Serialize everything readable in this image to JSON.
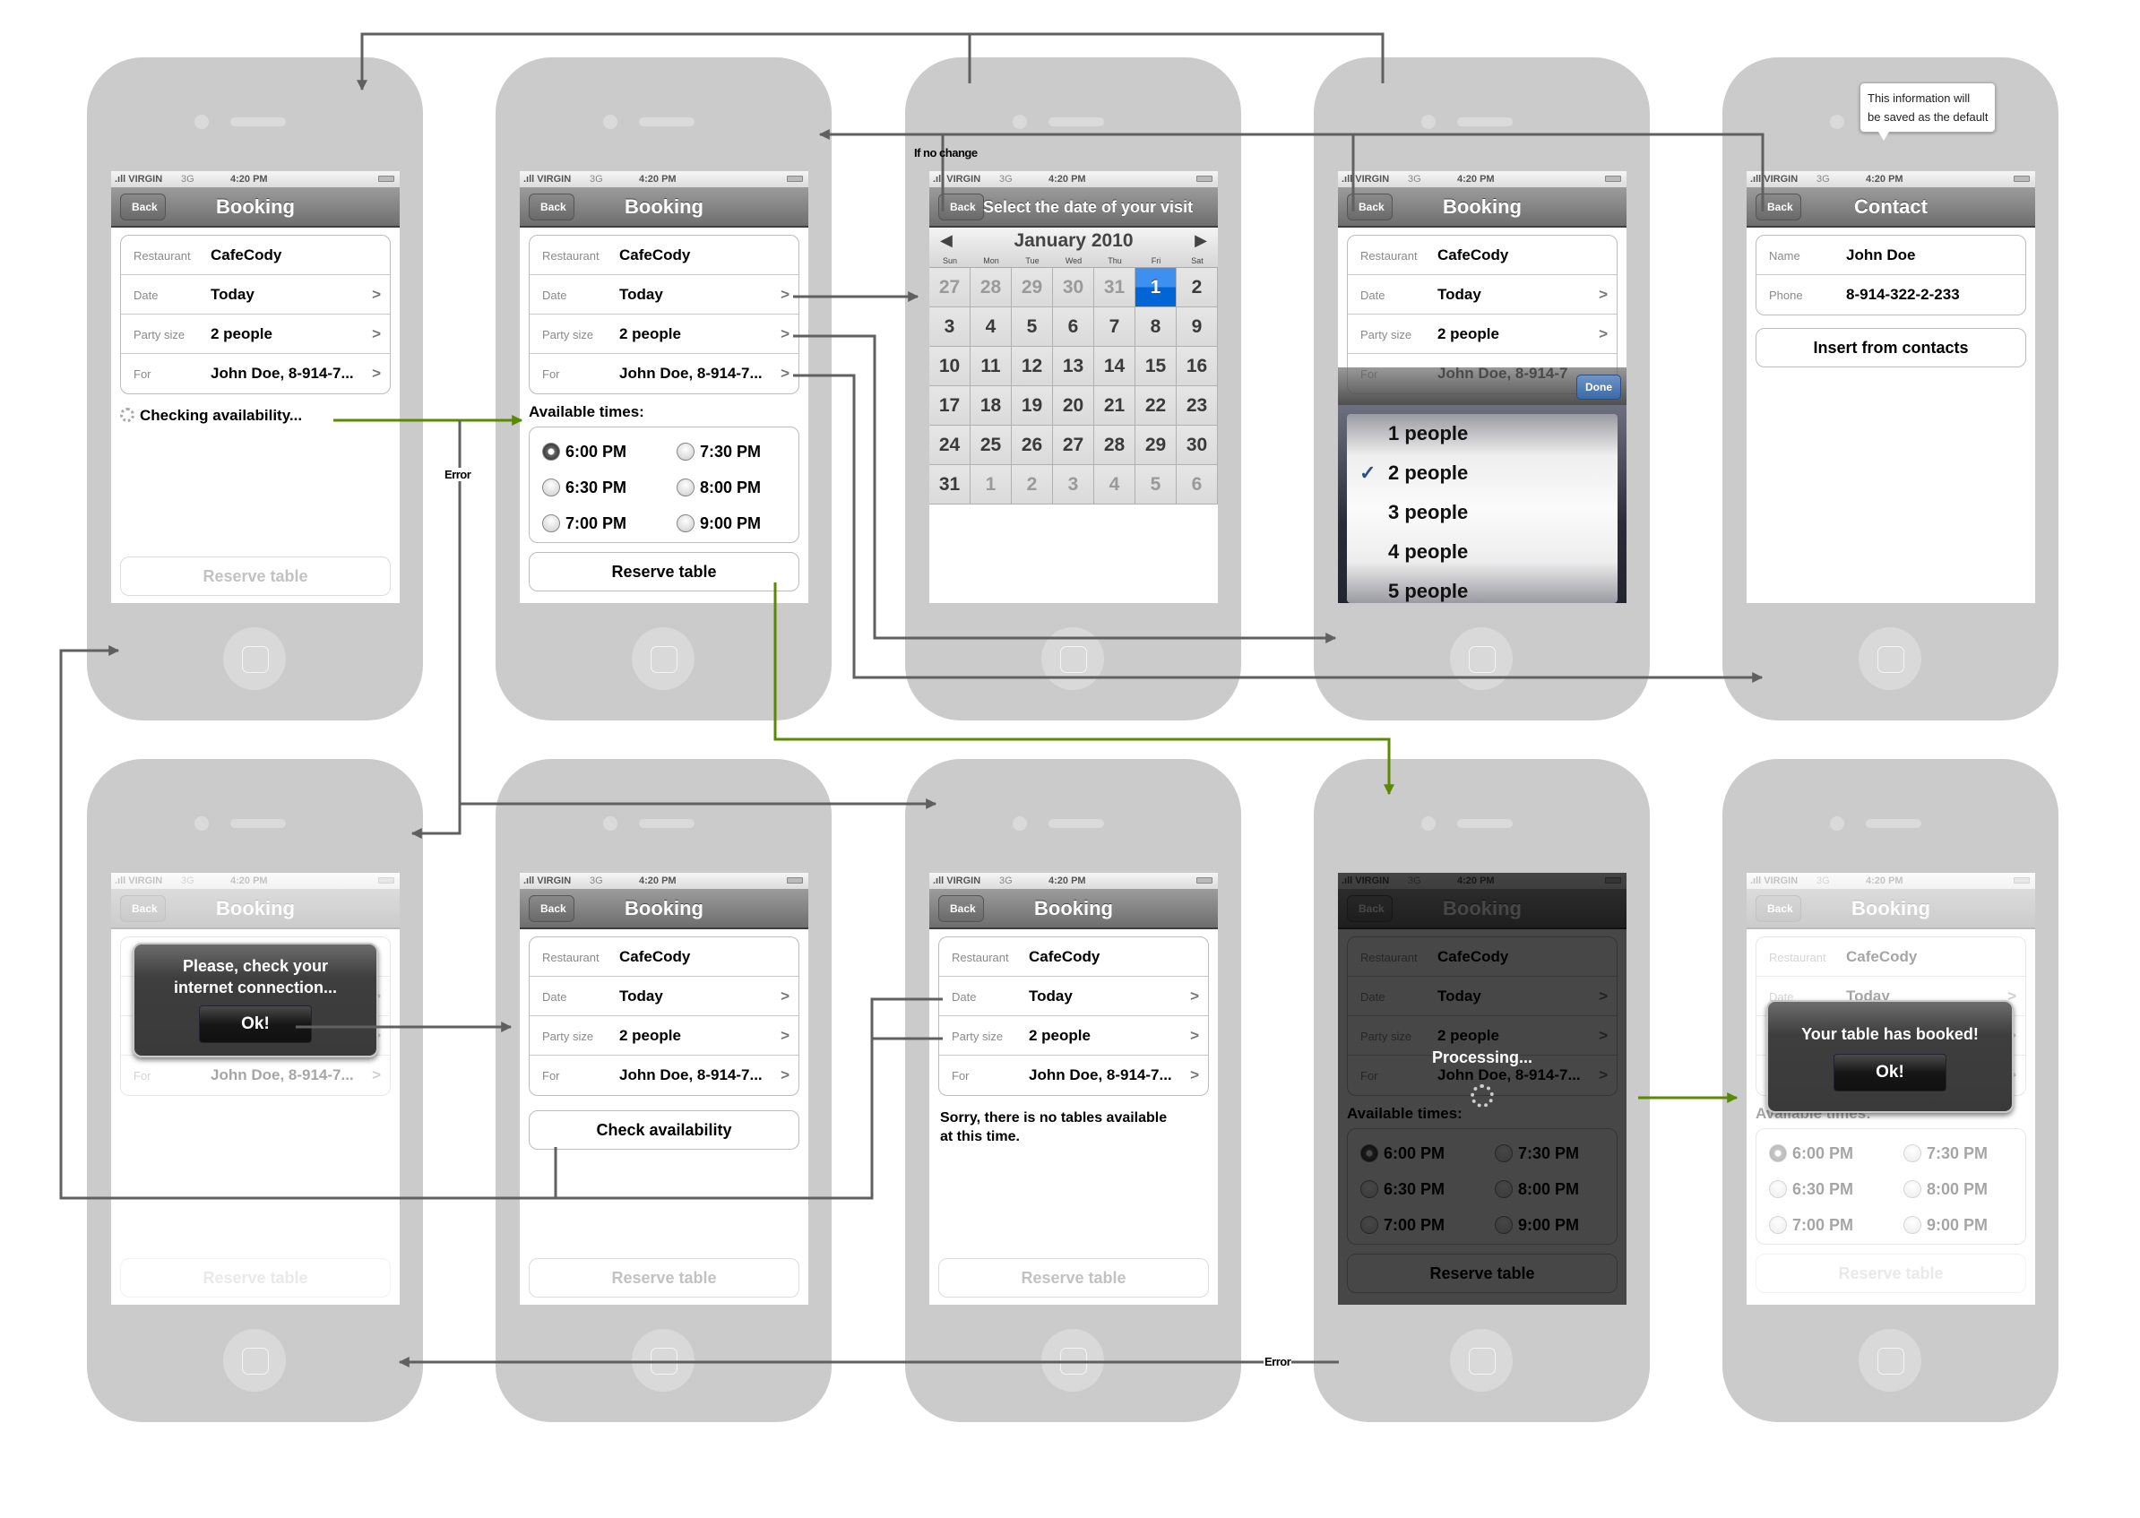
{
  "status": {
    "carrier": ".ıll VIRGIN",
    "network": "3G",
    "time": "4:20 PM"
  },
  "nav": {
    "back": "Back",
    "booking": "Booking",
    "select_date": "Select the date of your visit",
    "contact": "Contact"
  },
  "fields": {
    "restaurant_label": "Restaurant",
    "restaurant_value": "CafeCody",
    "date_label": "Date",
    "date_value": "Today",
    "party_label": "Party size",
    "party_value": "2 people",
    "for_label": "For",
    "for_value": "John Doe, 8-914-7...",
    "for_value_cut": "John Doe, 8-914-7"
  },
  "buttons": {
    "reserve": "Reserve table",
    "check": "Check availability",
    "insert_contacts": "Insert from contacts",
    "done": "Done",
    "ok": "Ok!"
  },
  "checking": "Checking availability...",
  "available_label": "Available times:",
  "times": [
    {
      "label": "6:00 PM",
      "selected": true
    },
    {
      "label": "7:30 PM",
      "selected": false
    },
    {
      "label": "6:30 PM",
      "selected": false
    },
    {
      "label": "8:00 PM",
      "selected": false
    },
    {
      "label": "7:00 PM",
      "selected": false
    },
    {
      "label": "9:00 PM",
      "selected": false
    }
  ],
  "calendar": {
    "month": "January 2010",
    "prev": "◀",
    "next": "▶",
    "weekdays": [
      "Sun",
      "Mon",
      "Tue",
      "Wed",
      "Thu",
      "Fri",
      "Sat"
    ],
    "days": [
      {
        "d": "27",
        "o": true
      },
      {
        "d": "28",
        "o": true
      },
      {
        "d": "29",
        "o": true
      },
      {
        "d": "30",
        "o": true
      },
      {
        "d": "31",
        "o": true
      },
      {
        "d": "1",
        "s": true
      },
      {
        "d": "2"
      },
      {
        "d": "3"
      },
      {
        "d": "4"
      },
      {
        "d": "5"
      },
      {
        "d": "6"
      },
      {
        "d": "7"
      },
      {
        "d": "8"
      },
      {
        "d": "9"
      },
      {
        "d": "10"
      },
      {
        "d": "11"
      },
      {
        "d": "12"
      },
      {
        "d": "13"
      },
      {
        "d": "14"
      },
      {
        "d": "15"
      },
      {
        "d": "16"
      },
      {
        "d": "17"
      },
      {
        "d": "18"
      },
      {
        "d": "19"
      },
      {
        "d": "20"
      },
      {
        "d": "21"
      },
      {
        "d": "22"
      },
      {
        "d": "23"
      },
      {
        "d": "24"
      },
      {
        "d": "25"
      },
      {
        "d": "26"
      },
      {
        "d": "27"
      },
      {
        "d": "28"
      },
      {
        "d": "29"
      },
      {
        "d": "30"
      },
      {
        "d": "31"
      },
      {
        "d": "1",
        "o": true
      },
      {
        "d": "2",
        "o": true
      },
      {
        "d": "3",
        "o": true
      },
      {
        "d": "4",
        "o": true
      },
      {
        "d": "5",
        "o": true
      },
      {
        "d": "6",
        "o": true
      }
    ]
  },
  "picker": {
    "options": [
      "1 people",
      "2 people",
      "3 people",
      "4 people",
      "5 people"
    ],
    "selected": "2 people",
    "check": "✓"
  },
  "contact": {
    "name_label": "Name",
    "name_value": "John Doe",
    "phone_label": "Phone",
    "phone_value": "8-914-322-2-233"
  },
  "tooltip": {
    "line1": "This information will",
    "line2": "be saved as the default"
  },
  "alerts": {
    "connection_line1": "Please, check your",
    "connection_line2": "internet connection...",
    "booked": "Your table has booked!"
  },
  "processing": "Processing...",
  "sorry_line1": "Sorry, there is no tables available",
  "sorry_line2": "at this time.",
  "annotations": {
    "if_no_change": "If no change",
    "error": "Error"
  },
  "colors": {
    "success_flow": "#5a8a00",
    "flow": "#606060",
    "selected_day": "#0a6fe0"
  }
}
